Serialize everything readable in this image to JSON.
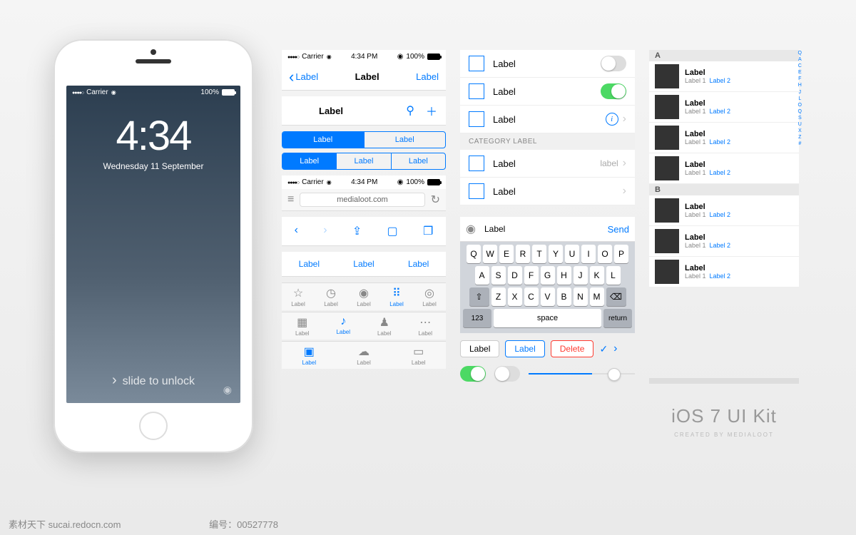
{
  "status": {
    "carrier": "Carrier",
    "time": "4:34 PM",
    "battery": "100%"
  },
  "lock": {
    "time": "4:34",
    "date": "Wednesday 11 September",
    "slide": "slide to unlock"
  },
  "nav": {
    "back": "Label",
    "title": "Label",
    "action": "Label"
  },
  "nav2": {
    "title": "Label"
  },
  "seg2": [
    "Label",
    "Label"
  ],
  "seg3": [
    "Label",
    "Label",
    "Label"
  ],
  "safari": {
    "url": "medialoot.com"
  },
  "textRow": [
    "Label",
    "Label",
    "Label"
  ],
  "tabs1": [
    "Label",
    "Label",
    "Label",
    "Label",
    "Label"
  ],
  "tabs2": [
    "Label",
    "Label",
    "Label",
    "Label"
  ],
  "tabs3": [
    "Label",
    "Label",
    "Label"
  ],
  "list": {
    "r1": "Label",
    "r2": "Label",
    "r3": "Label",
    "section": "CATEGORY LABEL",
    "r4": "Label",
    "r4d": "label",
    "r5": "Label"
  },
  "input": {
    "label": "Label",
    "send": "Send"
  },
  "keys": {
    "row1": [
      "Q",
      "W",
      "E",
      "R",
      "T",
      "Y",
      "U",
      "I",
      "O",
      "P"
    ],
    "row2": [
      "A",
      "S",
      "D",
      "F",
      "G",
      "H",
      "J",
      "K",
      "L"
    ],
    "row3": [
      "Z",
      "X",
      "C",
      "V",
      "B",
      "N",
      "M"
    ],
    "num": "123",
    "space": "space",
    "return": "return"
  },
  "buttons": {
    "b1": "Label",
    "b2": "Label",
    "b3": "Delete"
  },
  "index": {
    "a": "A",
    "b": "B",
    "label": "Label",
    "sub1": "Label 1",
    "sub2": "Label 2",
    "letters": "Q\nA\nC\nE\nF\nH\nJ\nL\nO\nQ\nS\nU\nX\nZ\n#"
  },
  "title": {
    "main": "iOS 7 UI Kit",
    "sub": "CREATED BY MEDIALOOT"
  },
  "footer": {
    "site": "素材天下 sucai.redocn.com",
    "idlabel": "编号：",
    "id": "00527778"
  }
}
